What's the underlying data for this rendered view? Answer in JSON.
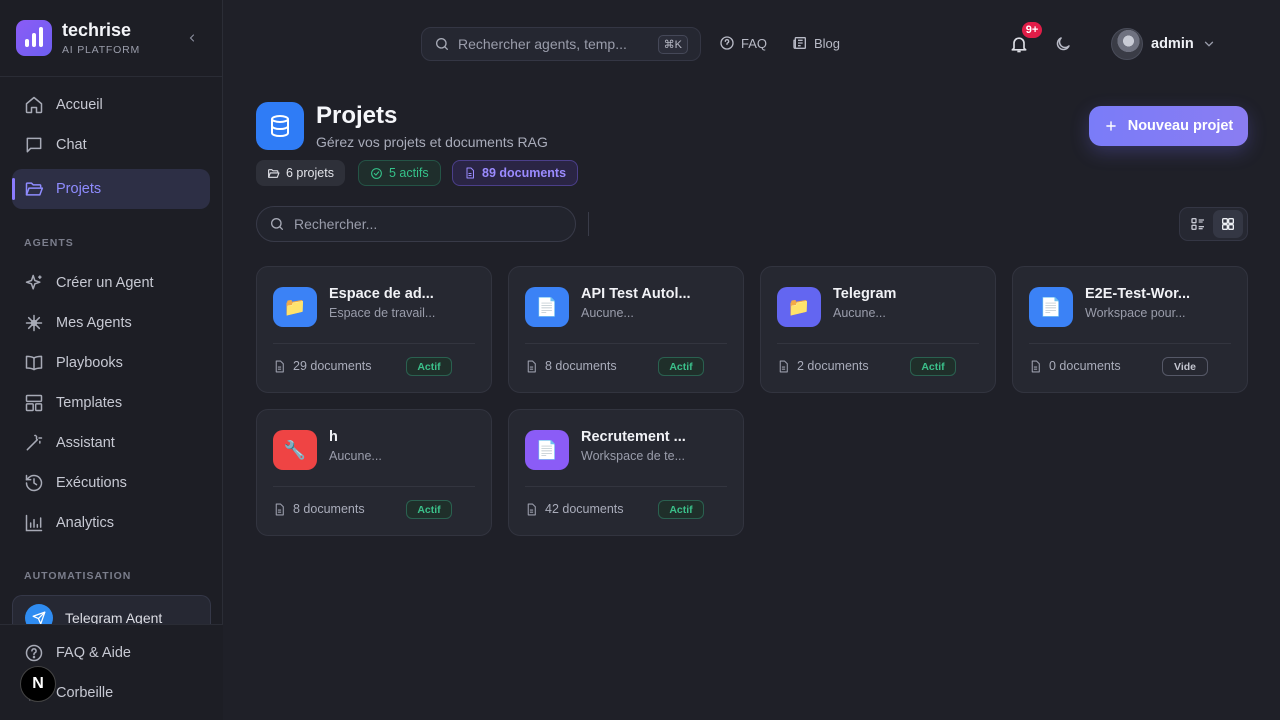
{
  "brand": {
    "name": "techrise",
    "subtitle": "AI PLATFORM"
  },
  "sidebar": {
    "main_items": [
      {
        "label": "Accueil",
        "icon": "home-icon"
      },
      {
        "label": "Chat",
        "icon": "chat-icon"
      },
      {
        "label": "Projets",
        "icon": "folder-icon",
        "active": true
      }
    ],
    "agents_label": "AGENTS",
    "agent_items": [
      {
        "label": "Créer un Agent",
        "icon": "sparkles-icon"
      },
      {
        "label": "Mes Agents",
        "icon": "asterisk-icon"
      },
      {
        "label": "Playbooks",
        "icon": "book-icon"
      },
      {
        "label": "Templates",
        "icon": "layout-icon"
      },
      {
        "label": "Assistant",
        "icon": "wand-icon"
      },
      {
        "label": "Exécutions",
        "icon": "history-icon"
      },
      {
        "label": "Analytics",
        "icon": "bar-chart-icon"
      }
    ],
    "automation_label": "AUTOMATISATION",
    "automation_item": {
      "label": "Telegram Agent",
      "icon": "telegram-icon"
    },
    "bottom_items": [
      {
        "label": "FAQ & Aide",
        "icon": "help-icon"
      },
      {
        "label": "Corbeille",
        "icon": "trash-icon"
      }
    ],
    "next_badge": "N"
  },
  "header": {
    "search_placeholder": "Rechercher agents, temp...",
    "search_shortcut": "⌘K",
    "faq_label": "FAQ",
    "blog_label": "Blog",
    "notification_count": "9+",
    "user_name": "admin"
  },
  "page": {
    "title": "Projets",
    "subtitle": "Gérez vos projets et documents RAG",
    "stats": {
      "projects": "6 projets",
      "active": "5 actifs",
      "documents": "89 documents"
    },
    "new_button": "Nouveau projet",
    "search_placeholder": "Rechercher..."
  },
  "colors": {
    "accent": "#8b7bff",
    "active": "#3bc08a",
    "primary_button": "#7a7cf8"
  },
  "projects": [
    {
      "title": "Espace de ad...",
      "desc": "Espace de travail...",
      "docs": "29 documents",
      "status": "Actif",
      "icon": "📁",
      "icon_bg": "#3b82f6"
    },
    {
      "title": "API Test Autol...",
      "desc": "Aucune...",
      "docs": "8 documents",
      "status": "Actif",
      "icon": "📄",
      "icon_bg": "#3b82f6"
    },
    {
      "title": "Telegram",
      "desc": "Aucune...",
      "docs": "2 documents",
      "status": "Actif",
      "icon": "📁",
      "icon_bg": "#6366f1"
    },
    {
      "title": "E2E-Test-Wor...",
      "desc": "Workspace pour...",
      "docs": "0 documents",
      "status": "Vide",
      "icon": "📄",
      "icon_bg": "#3b82f6"
    },
    {
      "title": "h",
      "desc": "Aucune...",
      "docs": "8 documents",
      "status": "Actif",
      "icon": "🔧",
      "icon_bg": "#ef4444"
    },
    {
      "title": "Recrutement ...",
      "desc": "Workspace de te...",
      "docs": "42 documents",
      "status": "Actif",
      "icon": "📄",
      "icon_bg": "#8b5cf6"
    }
  ]
}
